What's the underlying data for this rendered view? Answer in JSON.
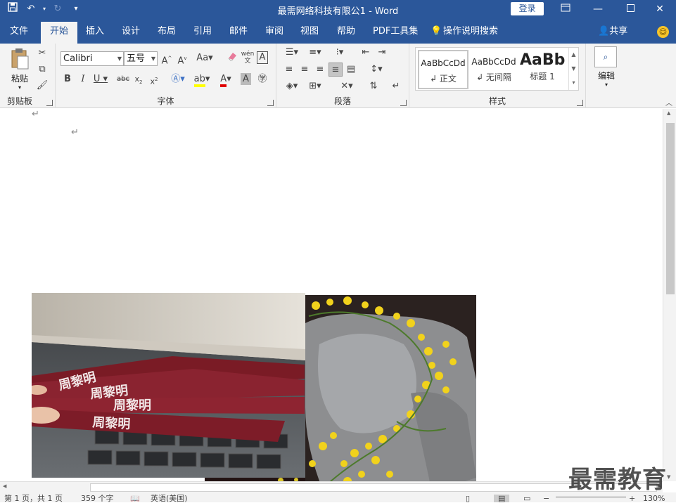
{
  "window": {
    "title": "最需网络科技有限公1  -  Word",
    "login_label": "登录"
  },
  "qat": {
    "save_icon": "save-icon",
    "undo_icon": "undo-icon",
    "redo_icon": "redo-icon",
    "customize_icon": "customize-icon"
  },
  "tabs": [
    {
      "label": "文件"
    },
    {
      "label": "开始"
    },
    {
      "label": "插入"
    },
    {
      "label": "设计"
    },
    {
      "label": "布局"
    },
    {
      "label": "引用"
    },
    {
      "label": "邮件"
    },
    {
      "label": "审阅"
    },
    {
      "label": "视图"
    },
    {
      "label": "帮助"
    },
    {
      "label": "PDF工具集"
    },
    {
      "label": "操作说明搜索"
    }
  ],
  "share_label": "共享",
  "ribbon": {
    "clipboard": {
      "paste_label": "粘贴",
      "group_label": "剪贴板"
    },
    "font": {
      "font_name": "Calibri",
      "font_size": "五号",
      "group_label": "字体",
      "wen_label": "wén",
      "char_A": "A"
    },
    "paragraph": {
      "group_label": "段落"
    },
    "styles": {
      "group_label": "样式",
      "items": [
        {
          "preview": "AaBbCcDd",
          "name": "↲ 正文"
        },
        {
          "preview": "AaBbCcDd",
          "name": "↲ 无间隔"
        },
        {
          "preview": "AaBb",
          "name": "标题 1"
        }
      ]
    },
    "editing": {
      "label": "编辑"
    }
  },
  "status": {
    "page": "第 1 页，共 1 页",
    "words": "359 个字",
    "language": "英语(美国)",
    "zoom": "130%"
  },
  "watermark": "最需教育",
  "colors": {
    "brand": "#2b579a",
    "highlight": "#ffff00",
    "font_color": "#e00000"
  }
}
